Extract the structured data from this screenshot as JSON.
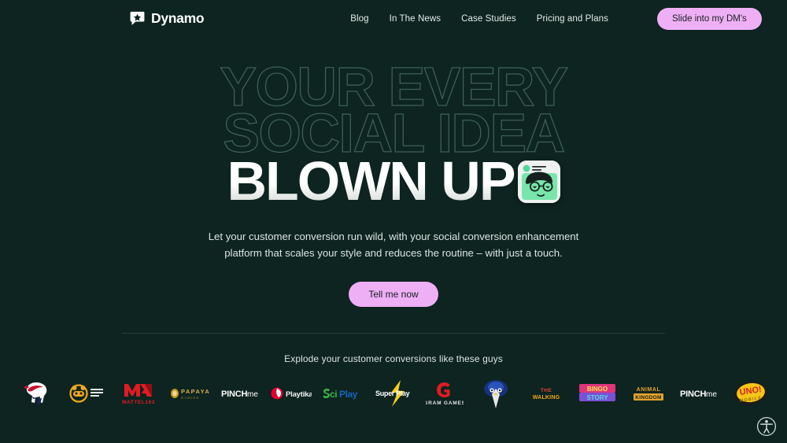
{
  "background_color": "#0d2420",
  "accent_pink": "#efaff5",
  "header": {
    "brand": {
      "name": "Dynamo",
      "mark_icon": "speech-bubble-star-icon"
    },
    "nav": [
      {
        "label": "Blog"
      },
      {
        "label": "In The News"
      },
      {
        "label": "Case Studies"
      },
      {
        "label": "Pricing and Plans"
      }
    ],
    "cta": {
      "label": "Slide into my DM's"
    }
  },
  "hero": {
    "headline_line1": "YOUR EVERY",
    "headline_line2": "SOCIAL IDEA",
    "headline_line3": "BLOWN UP",
    "avatar_icon": "avatar-card-icon",
    "subtitle_line1": "Let your customer conversion run wild, with your social conversion enhancement",
    "subtitle_line2": "platform that scales your style and reduces the routine – with just a touch.",
    "cta": {
      "label": "Tell me now"
    }
  },
  "clients": {
    "title": "Explode your customer conversions like these guys",
    "logos": [
      {
        "name": "elephant-logo",
        "label": ""
      },
      {
        "name": "bear-badge-logo",
        "label": ""
      },
      {
        "name": "mattel163-logo",
        "label": "MATTEL163"
      },
      {
        "name": "papaya-logo",
        "label": "PAPAYA"
      },
      {
        "name": "pinchme-logo",
        "label": "PINCHme"
      },
      {
        "name": "playtika-logo",
        "label": "Playtika"
      },
      {
        "name": "sciplay-logo",
        "label": "SciPlay"
      },
      {
        "name": "superplay-logo",
        "label": "SuperPlay"
      },
      {
        "name": "gram-games-logo",
        "label": "GRAM GAMES"
      },
      {
        "name": "blue-character-logo",
        "label": ""
      },
      {
        "name": "orange-title-logo",
        "label": ""
      },
      {
        "name": "colorful-title-logo",
        "label": ""
      },
      {
        "name": "animal-kingdom-logo",
        "label": "ANIMAL KINGDOM"
      },
      {
        "name": "pinchme-logo-2",
        "label": "PINCHme"
      },
      {
        "name": "uno-mobile-logo",
        "label": "UNO! MOBILE"
      }
    ]
  },
  "accessibility": {
    "icon": "accessibility-icon"
  }
}
